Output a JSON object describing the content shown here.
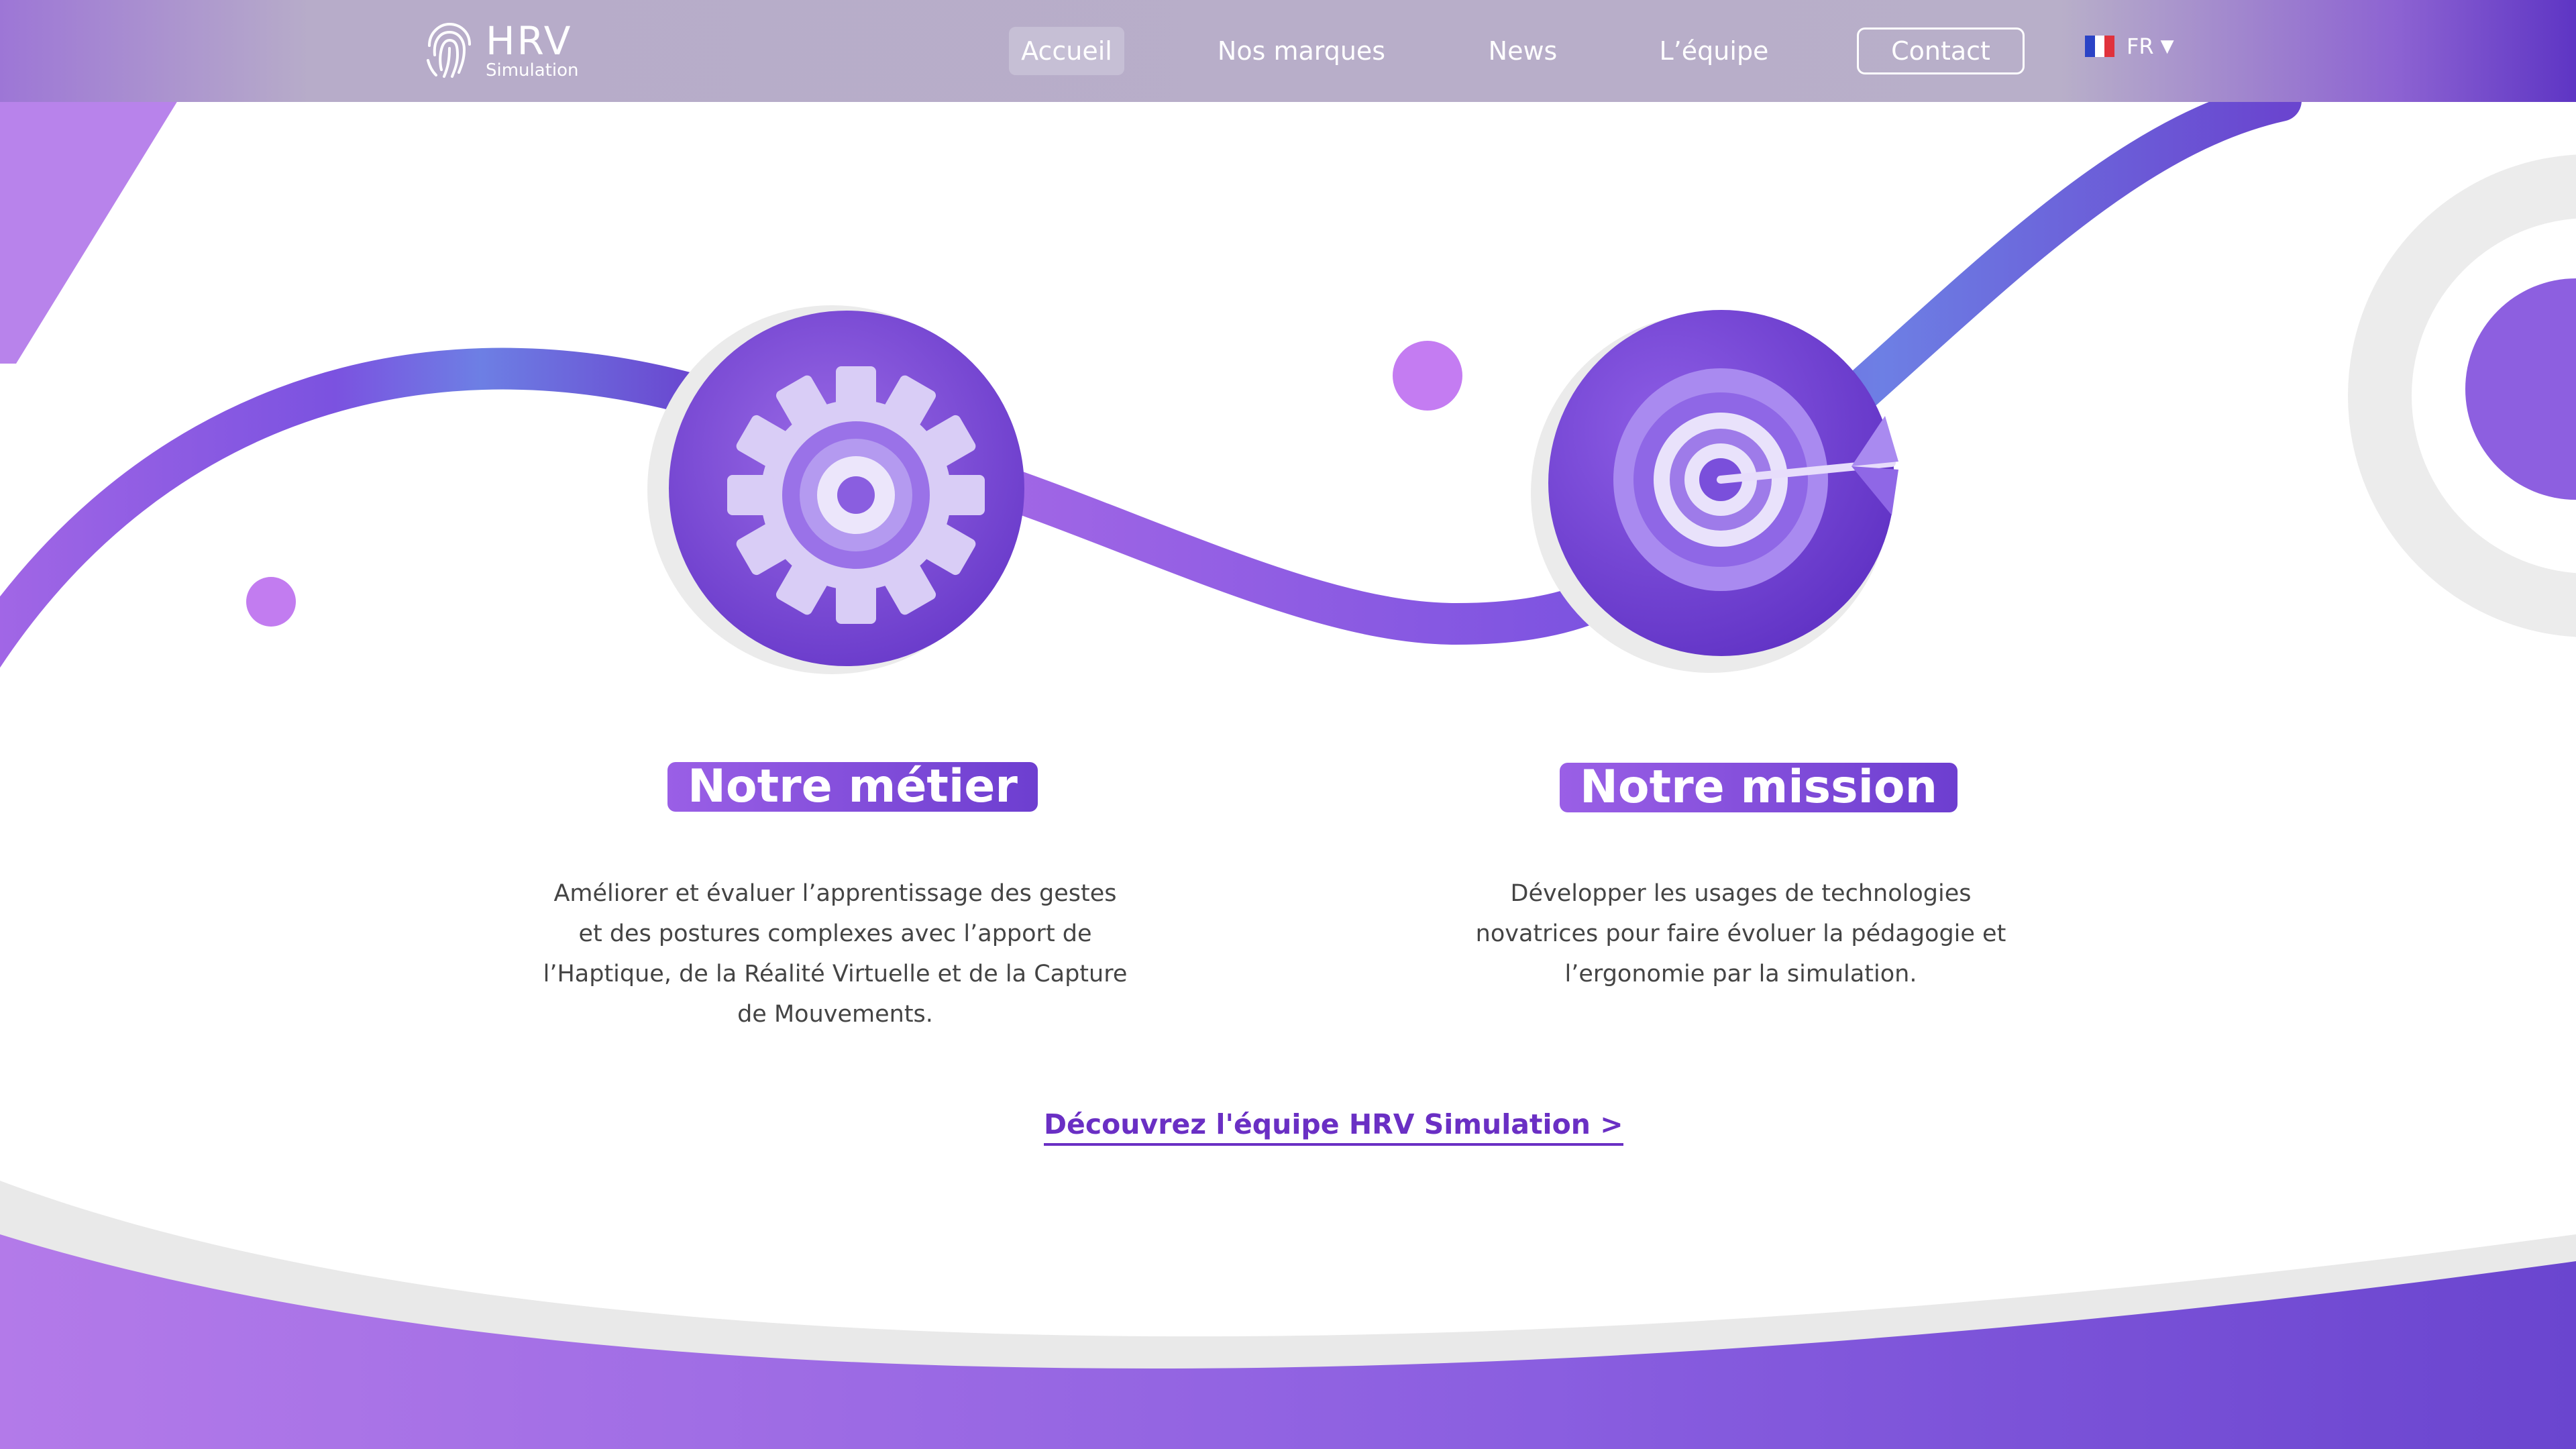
{
  "brand": {
    "logo_main": "HRV",
    "logo_sub": "Simulation"
  },
  "nav": {
    "items": [
      {
        "label": "Accueil",
        "active": true
      },
      {
        "label": "Nos marques"
      },
      {
        "label": "News"
      },
      {
        "label": "L’équipe"
      }
    ],
    "contact_label": "Contact",
    "language": "FR"
  },
  "sections": {
    "metier": {
      "title": "Notre métier",
      "text": "Améliorer et évaluer l’apprentissage des gestes et des postures complexes avec l’apport de l’Haptique, de la Réalité Virtuelle et de la Capture de Mouvements.",
      "icon": "gear-icon"
    },
    "mission": {
      "title": "Notre mission",
      "text": "Développer les usages de technologies novatrices pour faire évoluer la pédagogie et l’ergonomie par la simulation.",
      "icon": "target-dart-icon"
    }
  },
  "cta_label": "Découvrez l'équipe HRV Simulation >",
  "colors": {
    "accent": "#6a2fc4",
    "purple_light": "#b57cef",
    "purple_dark": "#5a3bc8"
  }
}
